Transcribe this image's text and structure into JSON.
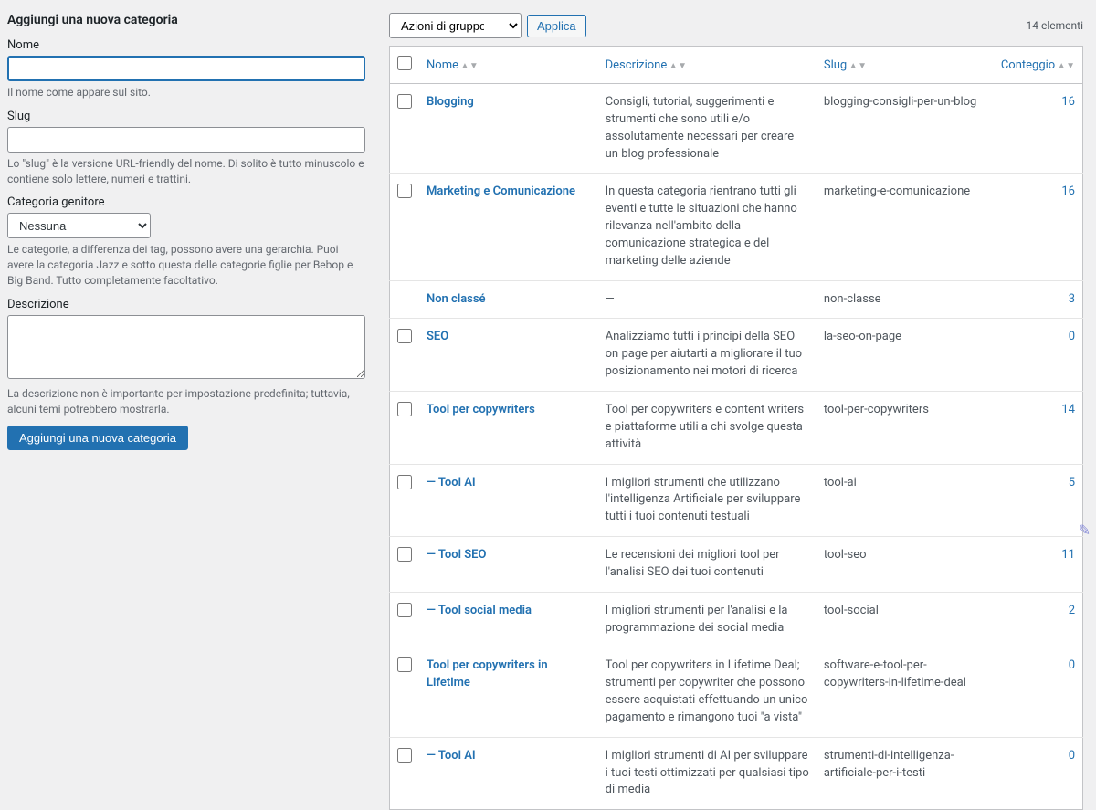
{
  "form": {
    "title": "Aggiungi una nuova categoria",
    "name_label": "Nome",
    "name_desc": "Il nome come appare sul sito.",
    "slug_label": "Slug",
    "slug_desc": "Lo \"slug\" è la versione URL-friendly del nome. Di solito è tutto minuscolo e contiene solo lettere, numeri e trattini.",
    "parent_label": "Categoria genitore",
    "parent_selected": "Nessuna",
    "parent_desc": "Le categorie, a differenza dei tag, possono avere una gerarchia. Puoi avere la categoria Jazz e sotto questa delle categorie figlie per Bebop e Big Band. Tutto completamente facoltativo.",
    "desc_label": "Descrizione",
    "desc_desc": "La descrizione non è importante per impostazione predefinita; tuttavia, alcuni temi potrebbero mostrarla.",
    "submit": "Aggiungi una nuova categoria"
  },
  "bulk": {
    "selected": "Azioni di gruppo",
    "apply": "Applica"
  },
  "count_text": "14 elementi",
  "columns": {
    "name": "Nome",
    "desc": "Descrizione",
    "slug": "Slug",
    "count": "Conteggio"
  },
  "rows": [
    {
      "name": "Blogging",
      "desc": "Consigli, tutorial, suggerimenti e strumenti che sono utili e/o assolutamente necessari per creare un blog professionale",
      "slug": "blogging-consigli-per-un-blog",
      "count": "16"
    },
    {
      "name": "Marketing e Comunicazione",
      "desc": "In questa categoria rientrano tutti gli eventi e tutte le situazioni che hanno rilevanza nell'ambito della comunicazione strategica e del marketing delle aziende",
      "slug": "marketing-e-comunicazione",
      "count": "16"
    },
    {
      "name": "Non classé",
      "desc": "—",
      "slug": "non-classe",
      "count": "3",
      "no_checkbox": true
    },
    {
      "name": "SEO",
      "desc": "Analizziamo tutti i principi della SEO on page per aiutarti a migliorare il tuo posizionamento nei motori di ricerca",
      "slug": "la-seo-on-page",
      "count": "0"
    },
    {
      "name": "Tool per copywriters",
      "desc": "Tool per copywriters e content writers e piattaforme utili a chi svolge questa attività",
      "slug": "tool-per-copywriters",
      "count": "14"
    },
    {
      "name": "— Tool AI",
      "desc": "I migliori strumenti che utilizzano l'intelligenza Artificiale per sviluppare tutti i tuoi contenuti testuali",
      "slug": "tool-ai",
      "count": "5"
    },
    {
      "name": "— Tool SEO",
      "desc": "Le recensioni dei migliori tool per l'analisi SEO dei tuoi contenuti",
      "slug": "tool-seo",
      "count": "11"
    },
    {
      "name": "— Tool social media",
      "desc": "I migliori strumenti per l'analisi e la programmazione dei social media",
      "slug": "tool-social",
      "count": "2"
    },
    {
      "name": "Tool per copywriters in Lifetime",
      "desc": "Tool per copywriters in Lifetime Deal; strumenti per copywriter che possono essere acquistati effettuando un unico pagamento e rimangono tuoi \"a vista\"",
      "slug": "software-e-tool-per-copywriters-in-lifetime-deal",
      "count": "0"
    },
    {
      "name": "— Tool AI",
      "desc": "I migliori strumenti di AI per sviluppare i tuoi testi ottimizzati per qualsiasi tipo di media",
      "slug": "strumenti-di-intelligenza-artificiale-per-i-testi",
      "count": "0"
    }
  ]
}
